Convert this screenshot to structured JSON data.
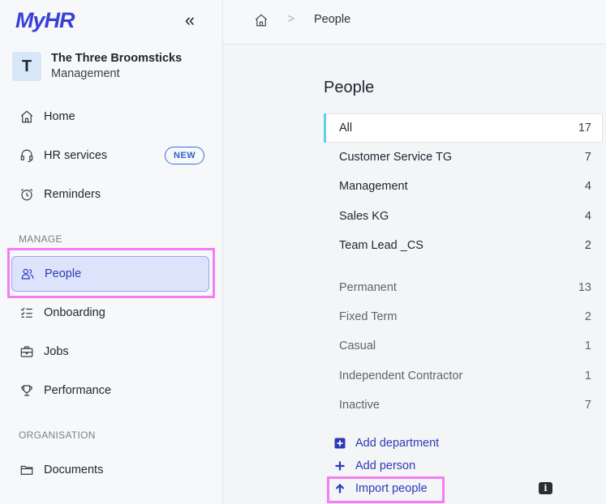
{
  "brand": {
    "logo": "MyHR"
  },
  "sidebar": {
    "org_avatar": "T",
    "org_name": "The Three Broomsticks",
    "org_role": "Management",
    "items_top": [
      {
        "label": "Home",
        "icon": "home-icon"
      },
      {
        "label": "HR services",
        "icon": "headset-icon",
        "badge": "NEW"
      },
      {
        "label": "Reminders",
        "icon": "alarm-clock-icon"
      }
    ],
    "manage_label": "MANAGE",
    "items_manage": [
      {
        "label": "People",
        "icon": "people-icon",
        "active": true
      },
      {
        "label": "Onboarding",
        "icon": "checklist-icon"
      },
      {
        "label": "Jobs",
        "icon": "briefcase-icon"
      },
      {
        "label": "Performance",
        "icon": "trophy-icon"
      }
    ],
    "organisation_label": "ORGANISATION",
    "items_org": [
      {
        "label": "Documents",
        "icon": "folder-icon"
      }
    ]
  },
  "breadcrumb": {
    "current": "People",
    "separator": ">"
  },
  "main": {
    "title": "People",
    "filters": [
      {
        "label": "All",
        "count": "17",
        "selected": true
      },
      {
        "label": "Customer Service TG",
        "count": "7"
      },
      {
        "label": "Management",
        "count": "4"
      },
      {
        "label": "Sales KG",
        "count": "4"
      },
      {
        "label": "Team Lead _CS",
        "count": "2"
      }
    ],
    "status_filters": [
      {
        "label": "Permanent",
        "count": "13"
      },
      {
        "label": "Fixed Term",
        "count": "2"
      },
      {
        "label": "Casual",
        "count": "1"
      },
      {
        "label": "Independent Contractor",
        "count": "1"
      },
      {
        "label": "Inactive",
        "count": "7"
      }
    ],
    "actions": {
      "add_department": "Add department",
      "add_person": "Add person",
      "import_people": "Import people"
    },
    "info_badge": "i"
  },
  "colors": {
    "accent": "#2c3ab8",
    "highlight": "#f47cf6",
    "selected_bar": "#5ed3e6"
  }
}
